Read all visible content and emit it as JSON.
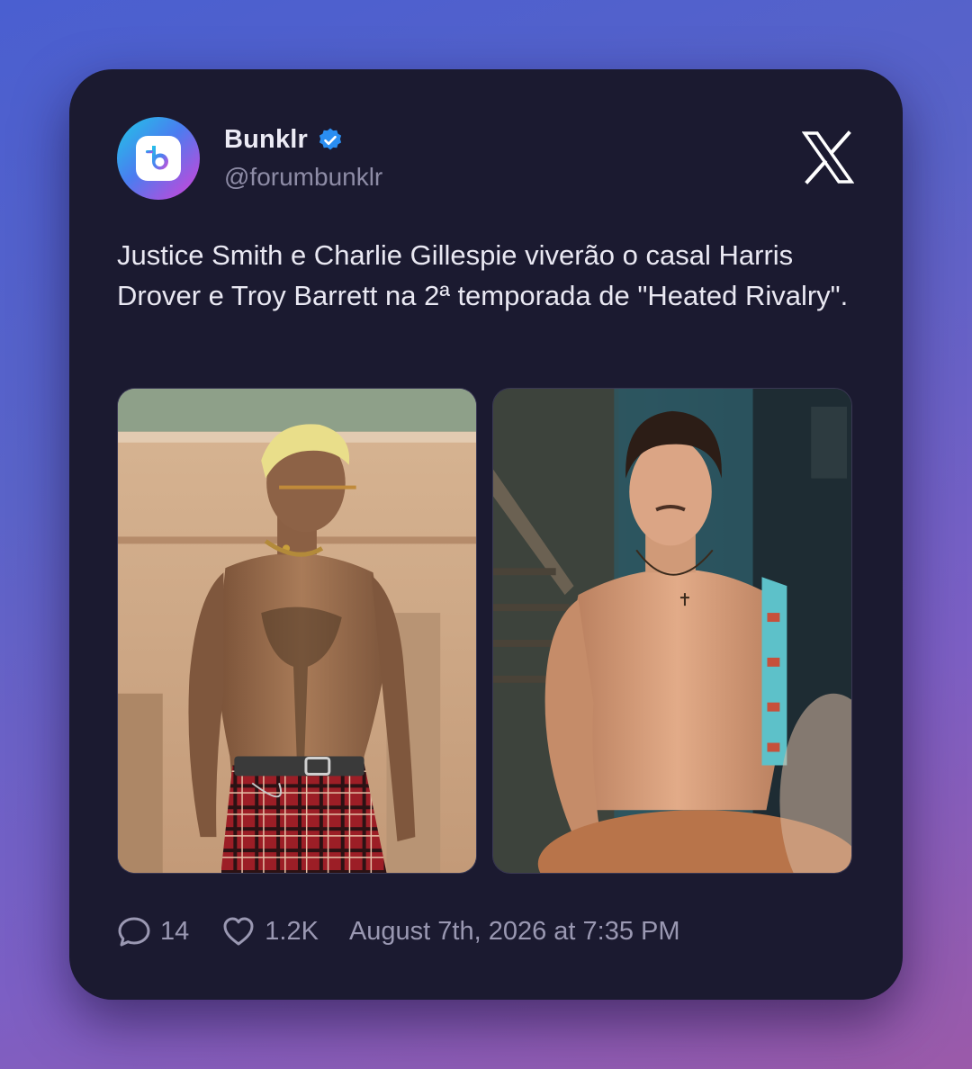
{
  "account": {
    "display_name": "Bunklr",
    "handle": "@forumbunklr",
    "verified": true
  },
  "tweet": {
    "text": "Justice Smith e Charlie Gillespie viverão o casal Harris Drover e Troy Barrett na 2ª temporada de \"Heated Rivalry\".",
    "media": [
      {
        "description": "shirtless-man-plaid-pants"
      },
      {
        "description": "shirtless-man-with-guitar"
      }
    ]
  },
  "stats": {
    "replies": "14",
    "likes": "1.2K",
    "timestamp": "August 7th, 2026 at 7:35 PM"
  },
  "icons": {
    "avatar": "bunklr-logo-icon",
    "verified": "verified-badge-icon",
    "brand": "x-logo-icon",
    "replies": "reply-icon",
    "likes": "heart-icon"
  },
  "colors": {
    "card_background": "#1b1a30",
    "verified_blue": "#2a8ef2",
    "text_primary": "#e9e8f2",
    "text_secondary": "#8e8ca6"
  }
}
